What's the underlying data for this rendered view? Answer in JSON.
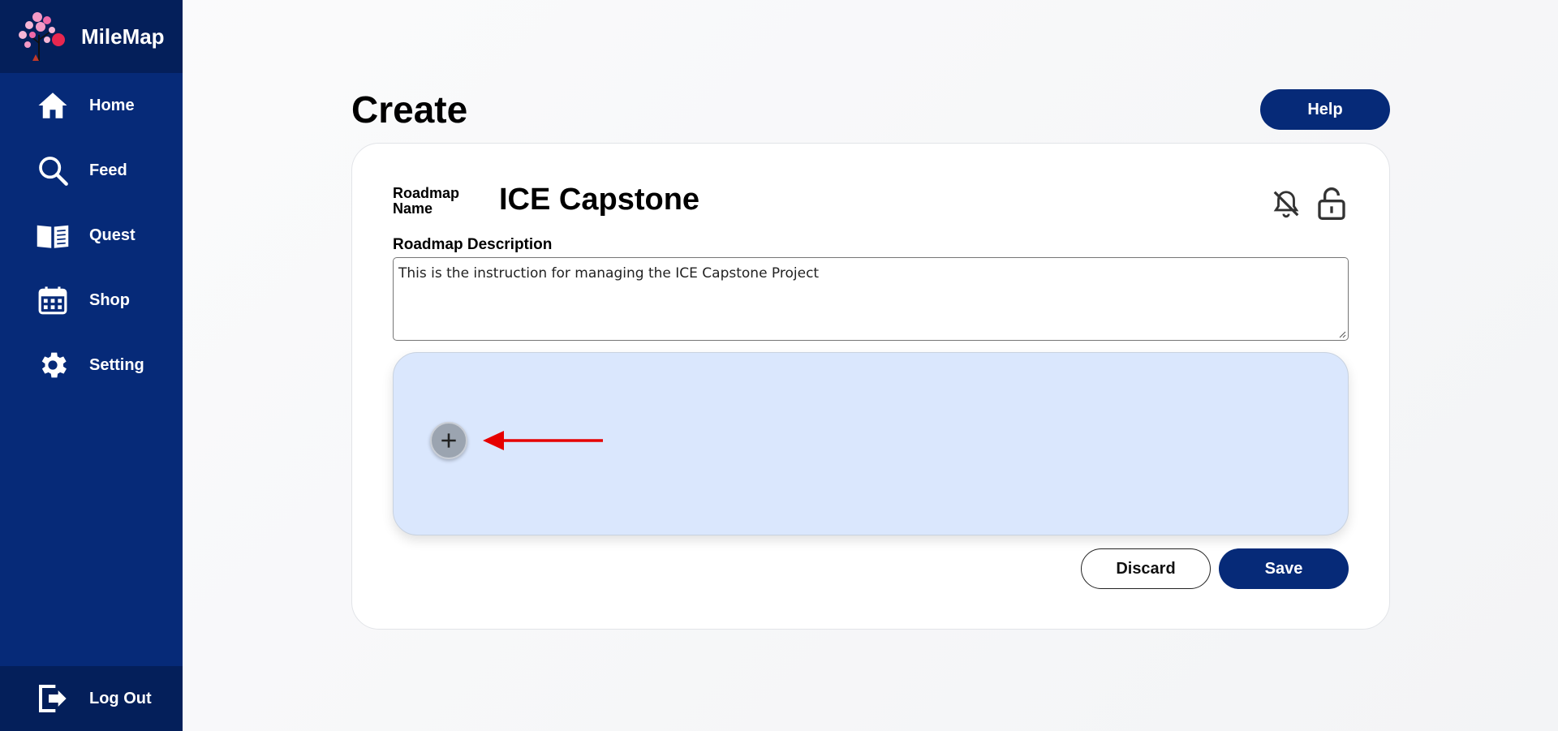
{
  "brand": {
    "name": "MileMap",
    "logo_icon": "tree-logo-icon"
  },
  "sidebar": {
    "items": [
      {
        "label": "Home",
        "icon": "home-icon"
      },
      {
        "label": "Feed",
        "icon": "search-icon"
      },
      {
        "label": "Quest",
        "icon": "book-icon"
      },
      {
        "label": "Shop",
        "icon": "calendar-icon"
      },
      {
        "label": "Setting",
        "icon": "gear-icon"
      }
    ],
    "logout": {
      "label": "Log Out",
      "icon": "logout-icon"
    }
  },
  "page": {
    "title": "Create",
    "help_label": "Help"
  },
  "roadmap": {
    "name_label": "Roadmap Name",
    "name_value": "ICE Capstone",
    "description_label": "Roadmap Description",
    "description_value": "This is the instruction for managing the ICE Capstone Project",
    "notifications_icon": "bell-off-icon",
    "visibility_icon": "unlock-icon"
  },
  "canvas": {
    "add_icon": "plus-icon",
    "annotation_icon": "arrow-left-annotation",
    "annotation_color": "#e60000"
  },
  "actions": {
    "discard_label": "Discard",
    "save_label": "Save"
  },
  "colors": {
    "primary": "#062a78",
    "sidebar_dark": "#041f5a",
    "canvas_bg": "#dae7fd"
  }
}
